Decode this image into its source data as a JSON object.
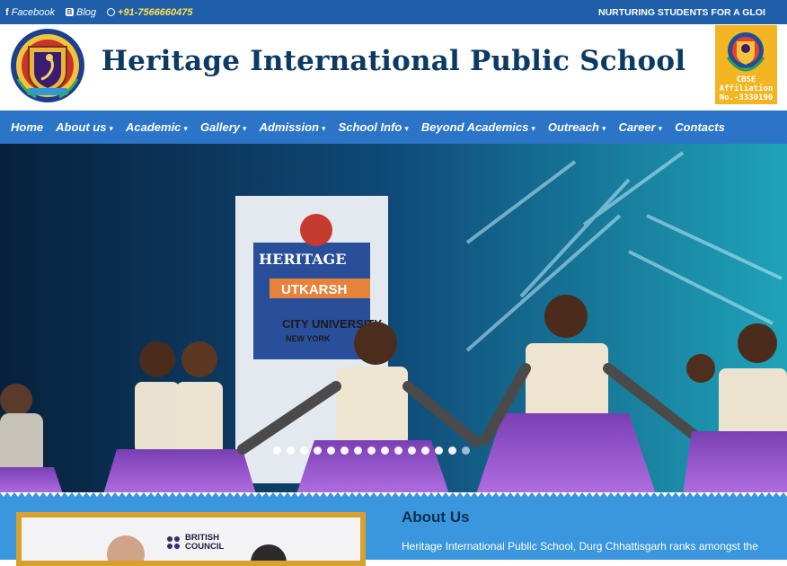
{
  "topbar": {
    "facebook": "Facebook",
    "blog": "Blog",
    "phone": "+91-7566660475",
    "ticker": "NURTURING STUDENTS FOR A GLOI"
  },
  "header": {
    "title": "Heritage International Public School",
    "cbse_line1": "CBSE",
    "cbse_line2": "Affiliation",
    "cbse_line3": "No.-3330190"
  },
  "nav": {
    "items": [
      {
        "label": "Home",
        "caret": ""
      },
      {
        "label": "About us",
        "caret": "▾"
      },
      {
        "label": "Academic",
        "caret": "▾"
      },
      {
        "label": "Gallery",
        "caret": "▾"
      },
      {
        "label": "Admission",
        "caret": "▾"
      },
      {
        "label": "School Info",
        "caret": "▾"
      },
      {
        "label": "Beyond Academics",
        "caret": "▾"
      },
      {
        "label": "Outreach",
        "caret": "▾"
      },
      {
        "label": "Career",
        "caret": "▾"
      },
      {
        "label": "Contacts",
        "caret": ""
      }
    ]
  },
  "hero": {
    "banner_line1": "HERITAGE",
    "banner_line2": "UTKARSH",
    "banner_line3": "CITY UNIVERSITY",
    "banner_line4": "NEW YORK",
    "slide_count": 15,
    "active_slide": 14
  },
  "about": {
    "title": "About Us",
    "text": "Heritage International Public School, Durg Chhattisgarh ranks amongst the",
    "photo_logo_line1": "BRITISH",
    "photo_logo_line2": "COUNCIL"
  },
  "colors": {
    "topbar": "#1f5faa",
    "nav": "#2b74c8",
    "title": "#0c3a63",
    "phone": "#ffe14d",
    "about_band": "#3a96dd"
  }
}
